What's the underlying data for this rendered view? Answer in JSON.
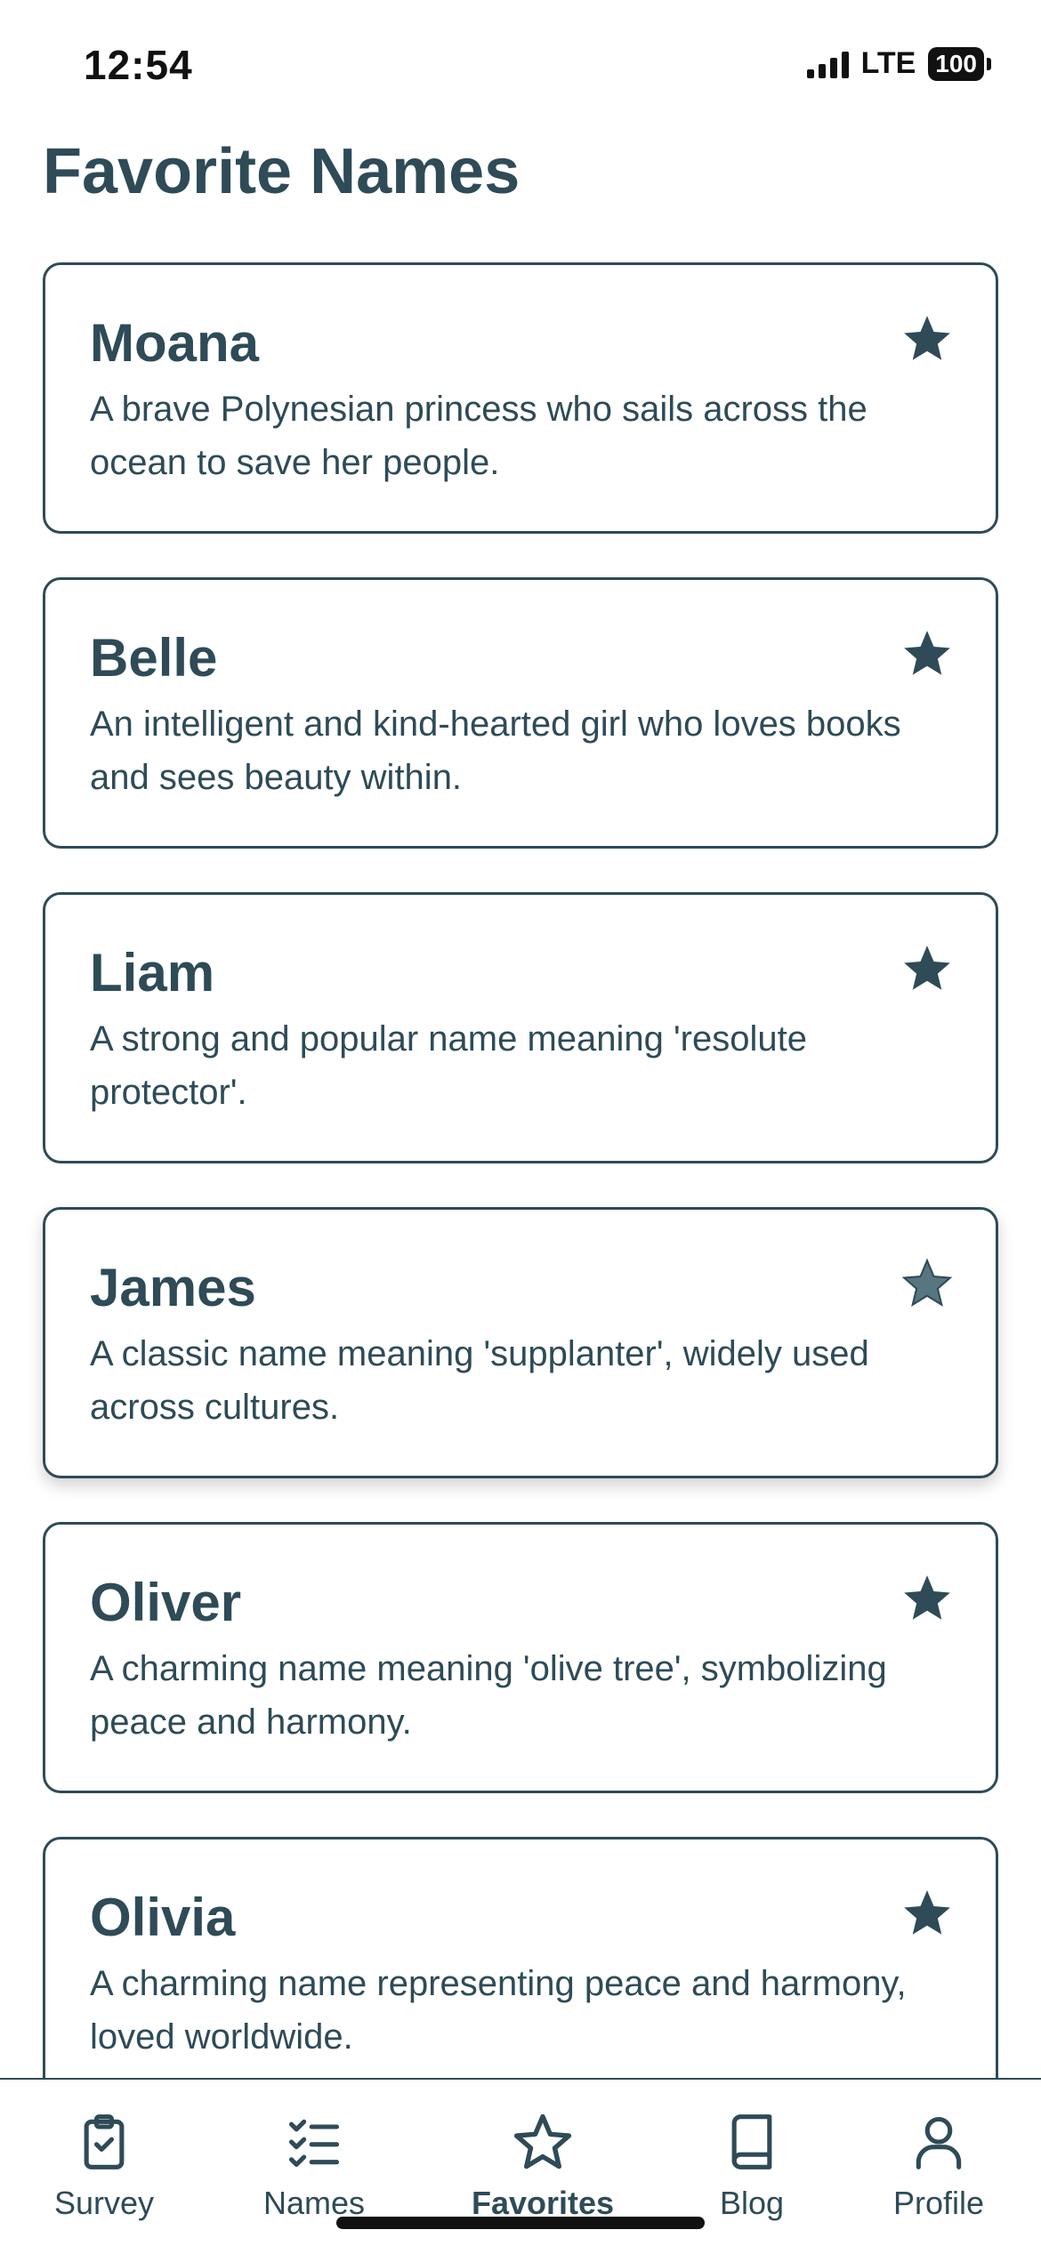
{
  "status_bar": {
    "time": "12:54",
    "network": "LTE",
    "battery": "100"
  },
  "page": {
    "title": "Favorite Names"
  },
  "favorites": [
    {
      "name": "Moana",
      "description": "A brave Polynesian princess who sails across the ocean to save her people.",
      "icon": "star-filled-icon"
    },
    {
      "name": "Belle",
      "description": "An intelligent and kind-hearted girl who loves books and sees beauty within.",
      "icon": "star-filled-icon"
    },
    {
      "name": "Liam",
      "description": "A strong and popular name meaning 'resolute protector'.",
      "icon": "star-filled-icon"
    },
    {
      "name": "James",
      "description": "A classic name meaning 'supplanter', widely used across cultures.",
      "icon": "star-filled-icon"
    },
    {
      "name": "Oliver",
      "description": "A charming name meaning 'olive tree', symbolizing peace and harmony.",
      "icon": "star-filled-icon"
    },
    {
      "name": "Olivia",
      "description": "A charming name representing peace and harmony, loved worldwide.",
      "icon": "star-filled-icon"
    }
  ],
  "tabs": [
    {
      "label": "Survey",
      "icon": "clipboard-check-icon"
    },
    {
      "label": "Names",
      "icon": "checklist-icon"
    },
    {
      "label": "Favorites",
      "icon": "star-outline-icon",
      "active": true
    },
    {
      "label": "Blog",
      "icon": "book-icon"
    },
    {
      "label": "Profile",
      "icon": "user-icon"
    }
  ],
  "colors": {
    "primary": "#2e4b57",
    "background": "#ffffff"
  }
}
